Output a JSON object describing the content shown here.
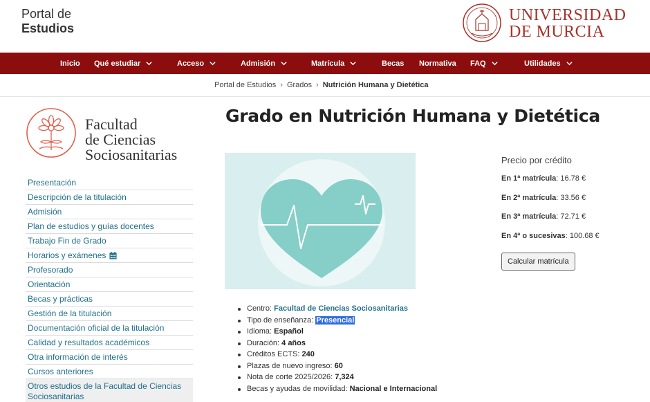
{
  "header": {
    "portal_line1": "Portal de",
    "portal_line2": "Estudios",
    "university_line1": "UNIVERSIDAD",
    "university_line2": "DE MURCIA"
  },
  "nav": {
    "items": [
      {
        "label": "Inicio",
        "has_dropdown": false
      },
      {
        "label": "Qué estudiar",
        "has_dropdown": true
      },
      {
        "label": "Acceso",
        "has_dropdown": true
      },
      {
        "label": "Admisión",
        "has_dropdown": true
      },
      {
        "label": "Matrícula",
        "has_dropdown": true
      },
      {
        "label": "Becas",
        "has_dropdown": false
      },
      {
        "label": "Normativa",
        "has_dropdown": false
      },
      {
        "label": "FAQ",
        "has_dropdown": true
      },
      {
        "label": "Utilidades",
        "has_dropdown": true
      }
    ]
  },
  "breadcrumb": {
    "items": [
      "Portal de Estudios",
      "Grados"
    ],
    "current": "Nutrición Humana y Dietética"
  },
  "faculty": {
    "name_line1": "Facultad",
    "name_line2": "de Ciencias",
    "name_line3": "Sociosanitarias"
  },
  "sidebar": {
    "items": [
      {
        "label": "Presentación"
      },
      {
        "label": "Descripción de la titulación"
      },
      {
        "label": "Admisión"
      },
      {
        "label": "Plan de estudios y guías docentes"
      },
      {
        "label": "Trabajo Fin de Grado"
      },
      {
        "label": "Horarios y exámenes",
        "icon": "calendar-icon"
      },
      {
        "label": "Profesorado"
      },
      {
        "label": "Orientación"
      },
      {
        "label": "Becas y prácticas"
      },
      {
        "label": "Gestión de la titulación"
      },
      {
        "label": "Documentación oficial de la titulación"
      },
      {
        "label": "Calidad y resultados académicos"
      },
      {
        "label": "Otra información de interés"
      },
      {
        "label": "Cursos anteriores"
      },
      {
        "label": "Otros estudios de la Facultad de Ciencias Sociosanitarias"
      }
    ]
  },
  "main": {
    "title": "Grado en Nutrición Humana y Dietética",
    "hero_icon": "heart-pulse-icon",
    "info": [
      {
        "label": "Centro: ",
        "value": "Facultad de Ciencias Sociosanitarias"
      },
      {
        "label": "Tipo de enseñanza: ",
        "value": "Presencial"
      },
      {
        "label": "Idioma: ",
        "value": "Español"
      },
      {
        "label": "Duración: ",
        "value": "4 años"
      },
      {
        "label": "Créditos ECTS: ",
        "value": "240"
      },
      {
        "label": "Plazas de nuevo ingreso: ",
        "value": "60"
      },
      {
        "label": "Nota de corte 2025/2026: ",
        "value": "7,324"
      },
      {
        "label": "Becas y ayudas de movilidad: ",
        "value": "Nacional e Internacional"
      }
    ]
  },
  "price": {
    "title": "Precio por crédito",
    "rows": [
      {
        "label": "En 1ª matrícula",
        "value": ": 16.78 €"
      },
      {
        "label": "En 2ª matrícula",
        "value": ": 33.56 €"
      },
      {
        "label": "En 3ª matrícula",
        "value": ": 72.71 €"
      },
      {
        "label": "En 4ª o sucesivas",
        "value": ": 100.68 €"
      }
    ],
    "button_label": "Calcular matrícula"
  },
  "colors": {
    "nav_bg": "#8c0d0d",
    "um_red": "#a8322a",
    "faculty_coral": "#e0614f",
    "link": "#1f6e8a",
    "hero_bg": "#d9eeee",
    "heart": "#86cfc8",
    "selection": "#2f6ce0"
  }
}
